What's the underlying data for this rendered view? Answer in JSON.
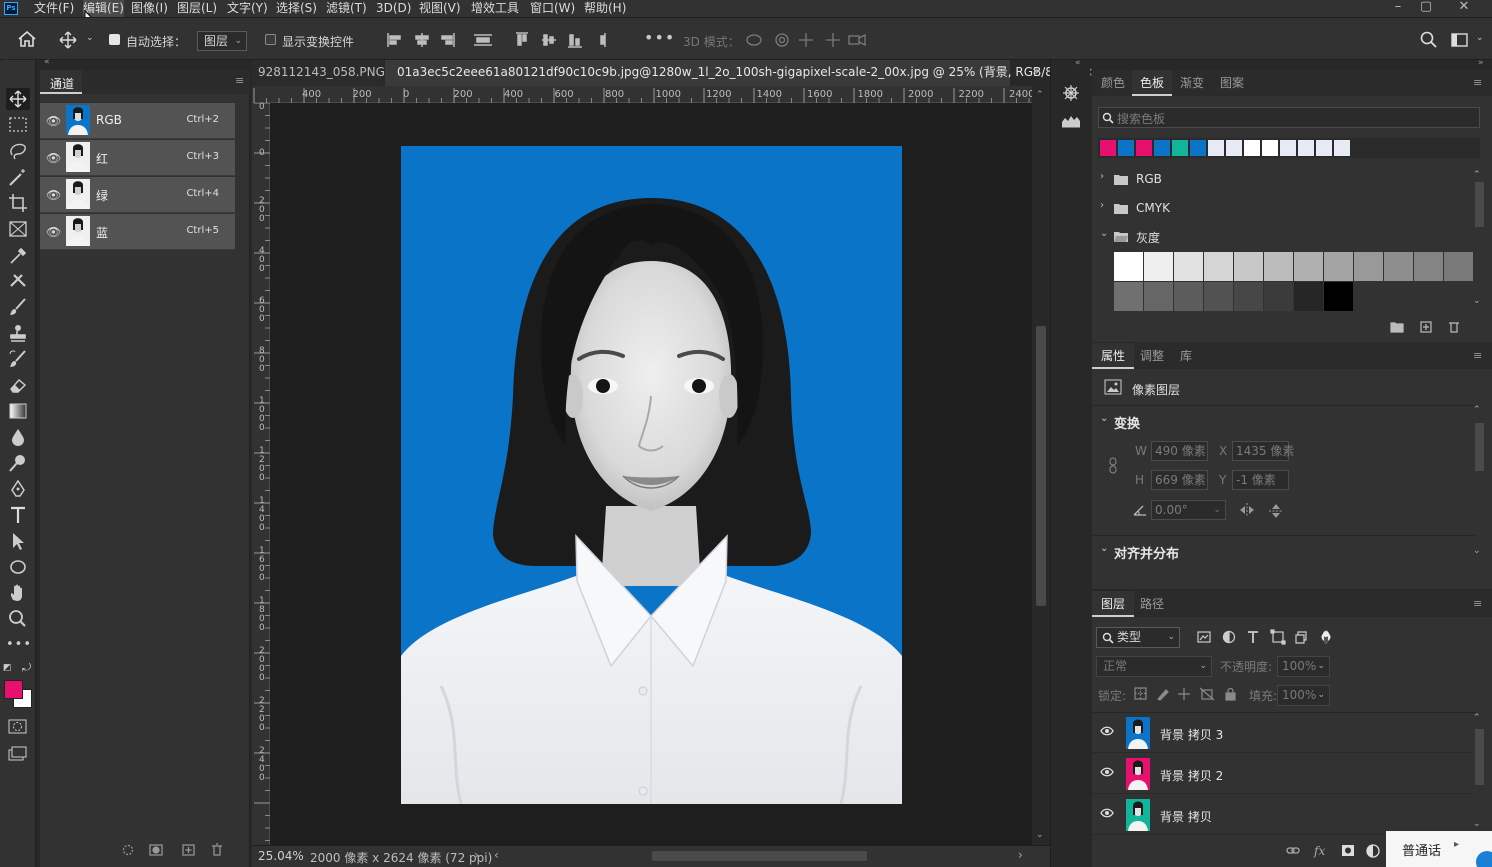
{
  "app": {
    "logo_text": "Ps"
  },
  "menu": [
    "文件(F)",
    "编辑(E)",
    "图像(I)",
    "图层(L)",
    "文字(Y)",
    "选择(S)",
    "滤镜(T)",
    "3D(D)",
    "视图(V)",
    "增效工具",
    "窗口(W)",
    "帮助(H)"
  ],
  "options": {
    "auto_select_label": "自动选择：",
    "auto_select_target": "图层",
    "show_transform_label": "显示变换控件",
    "mode_3d_label": "3D 模式："
  },
  "channels_panel": {
    "tab": "通道",
    "rows": [
      {
        "name": "RGB",
        "shortcut": "Ctrl+2",
        "thumb": "color"
      },
      {
        "name": "红",
        "shortcut": "Ctrl+3",
        "thumb": "gray"
      },
      {
        "name": "绿",
        "shortcut": "Ctrl+4",
        "thumb": "gray"
      },
      {
        "name": "蓝",
        "shortcut": "Ctrl+5",
        "thumb": "gray"
      }
    ]
  },
  "documents": {
    "tabs": [
      {
        "title": "928112143_058.PNG",
        "close": "×",
        "active": false
      },
      {
        "title": "01a3ec5c2eee61a80121df90c10c9b.jpg@1280w_1l_2o_100sh-gigapixel-scale-2_00x.jpg @ 25% (背景, RGB/8*) *",
        "close": "×",
        "active": true
      }
    ],
    "ruler_h": [
      "400",
      "200",
      "0",
      "200",
      "400",
      "600",
      "800",
      "1000",
      "1200",
      "1400",
      "1600",
      "1800",
      "2000",
      "2200",
      "2400"
    ],
    "ruler_v": [
      "0",
      "0",
      "2\n0\n0",
      "4\n0\n0",
      "6\n0\n0",
      "8\n0\n0",
      "1\n0\n0\n0",
      "1\n2\n0\n0",
      "1\n4\n0\n0",
      "1\n6\n0\n0",
      "1\n8\n0\n0",
      "2\n0\n0\n0",
      "2\n2\n0\n0",
      "2\n4\n0\n0"
    ],
    "zoom": "25.04%",
    "doc_info": "2000 像素 x 2624 像素 (72 ppi)"
  },
  "swatches_panel": {
    "tabs": [
      "颜色",
      "色板",
      "渐变",
      "图案"
    ],
    "active_tab": "色板",
    "search_placeholder": "搜索色板",
    "recent_colors": [
      "#e8106e",
      "#0b73c8",
      "#e8106e",
      "#0b73c8",
      "#10b59a",
      "#0b73c8",
      "#e6ebf5",
      "#e6ebf5",
      "#ffffff",
      "#ffffff",
      "#e6ebf5",
      "#e6ebf5",
      "#e6ebf5",
      "#e6ebf5"
    ],
    "groups": [
      {
        "name": "RGB",
        "expanded": false
      },
      {
        "name": "CMYK",
        "expanded": false
      },
      {
        "name": "灰度",
        "expanded": true
      }
    ],
    "gray_row1": [
      "#ffffff",
      "#efefef",
      "#e2e2e2",
      "#d5d5d5",
      "#c8c8c8",
      "#bcbcbc",
      "#b0b0b0",
      "#a4a4a4",
      "#999999",
      "#8e8e8e",
      "#848484",
      "#7a7a7a"
    ],
    "gray_row2": [
      "#707070",
      "#666666",
      "#5c5c5c",
      "#525252",
      "#474747",
      "#3b3b3b",
      "#262626",
      "#000000"
    ]
  },
  "properties_panel": {
    "tabs": [
      "属性",
      "调整",
      "库"
    ],
    "active_tab": "属性",
    "type_label": "像素图层",
    "transform_title": "变换",
    "w_label": "W",
    "w_value": "490 像素",
    "x_label": "X",
    "x_value": "1435 像素",
    "h_label": "H",
    "h_value": "669 像素",
    "y_label": "Y",
    "y_value": "-1 像素",
    "angle_value": "0.00°",
    "align_title": "对齐并分布"
  },
  "layers_panel": {
    "tabs": [
      "图层",
      "路径"
    ],
    "active_tab": "图层",
    "filter_kind": "类型",
    "blend_mode": "正常",
    "opacity_label": "不透明度:",
    "opacity_value": "100%",
    "lock_label": "锁定:",
    "fill_label": "填充:",
    "fill_value": "100%",
    "layers": [
      {
        "name": "背景 拷贝 3",
        "bg": "#0b73c8"
      },
      {
        "name": "背景 拷贝 2",
        "bg": "#e8106e"
      },
      {
        "name": "背景 拷贝",
        "bg": "#10b59a"
      }
    ]
  },
  "colors": {
    "foreground": "#e8106e",
    "background": "#ffffff",
    "photo_bg": "#0a74c9"
  },
  "ime": {
    "label": "普通话"
  }
}
